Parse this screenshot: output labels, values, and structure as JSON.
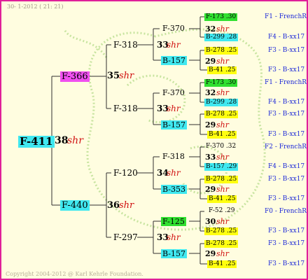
{
  "header": "30-  1-2012 ( 21: 21)",
  "copyright": "Copyright 2004-2012 @ Karl Kehrle Foundation.",
  "colors": {
    "frame": "#e0209a",
    "cyan": "#40e8f0",
    "magenta": "#f050f0",
    "green": "#30e030",
    "yellow": "#ffff10",
    "shr": "#d01010",
    "line": "#1c28d8"
  },
  "g1": {
    "name": "F-411",
    "num": "38",
    "shr": "shr"
  },
  "g2": [
    {
      "name": "F-366",
      "num": "35",
      "shr": "shr"
    },
    {
      "name": "F-440",
      "num": "36",
      "shr": "shr"
    }
  ],
  "g3": [
    {
      "name": "F-318",
      "num": "33",
      "shr": "shr"
    },
    {
      "name": "F-318",
      "num": "33",
      "shr": "shr"
    },
    {
      "name": "F-120",
      "num": "34",
      "shr": "shr"
    },
    {
      "name": "F-297",
      "num": "33",
      "shr": "shr"
    }
  ],
  "g4": [
    {
      "name": "F-370",
      "num": "32",
      "shr": "shr"
    },
    {
      "name": "B-157",
      "num": "29",
      "shr": "shr"
    },
    {
      "name": "F-370",
      "num": "32",
      "shr": "shr"
    },
    {
      "name": "B-157",
      "num": "29",
      "shr": "shr"
    },
    {
      "name": "F-318",
      "num": "33",
      "shr": "shr"
    },
    {
      "name": "B-353",
      "num": "29",
      "shr": "shr"
    },
    {
      "name": "F-125",
      "num": "30",
      "shr": "shr"
    },
    {
      "name": "B-157",
      "num": "29",
      "shr": "shr"
    }
  ],
  "g5": [
    {
      "name": "F-173 .30",
      "race": "F1 - FrenchR"
    },
    {
      "name": "B-299 .28",
      "race": "F4 - B-xx17"
    },
    {
      "name": "B-278 .25",
      "race": "F3 - B-xx17"
    },
    {
      "name": "B-41 .25",
      "race": "F3 - B-xx17"
    },
    {
      "name": "F-173 .30",
      "race": "F1 - FrenchR"
    },
    {
      "name": "B-299 .28",
      "race": "F4 - B-xx17"
    },
    {
      "name": "B-278 .25",
      "race": "F3 - B-xx17"
    },
    {
      "name": "B-41 .25",
      "race": "F3 - B-xx17"
    },
    {
      "name": "F-370 .32",
      "race": "F2 - FrenchR"
    },
    {
      "name": "B-157 .29",
      "race": "F4 - B-xx17"
    },
    {
      "name": "B-278 .25",
      "race": "F3 - B-xx17"
    },
    {
      "name": "B-41 .25",
      "race": "F3 - B-xx17"
    },
    {
      "name": "F-52 .29",
      "race": "F0 - FrenchR"
    },
    {
      "name": "B-278 .25",
      "race": "F3 - B-xx17"
    },
    {
      "name": "B-278 .25",
      "race": "F3 - B-xx17"
    },
    {
      "name": "B-41 .25",
      "race": "F3 - B-xx17"
    }
  ]
}
